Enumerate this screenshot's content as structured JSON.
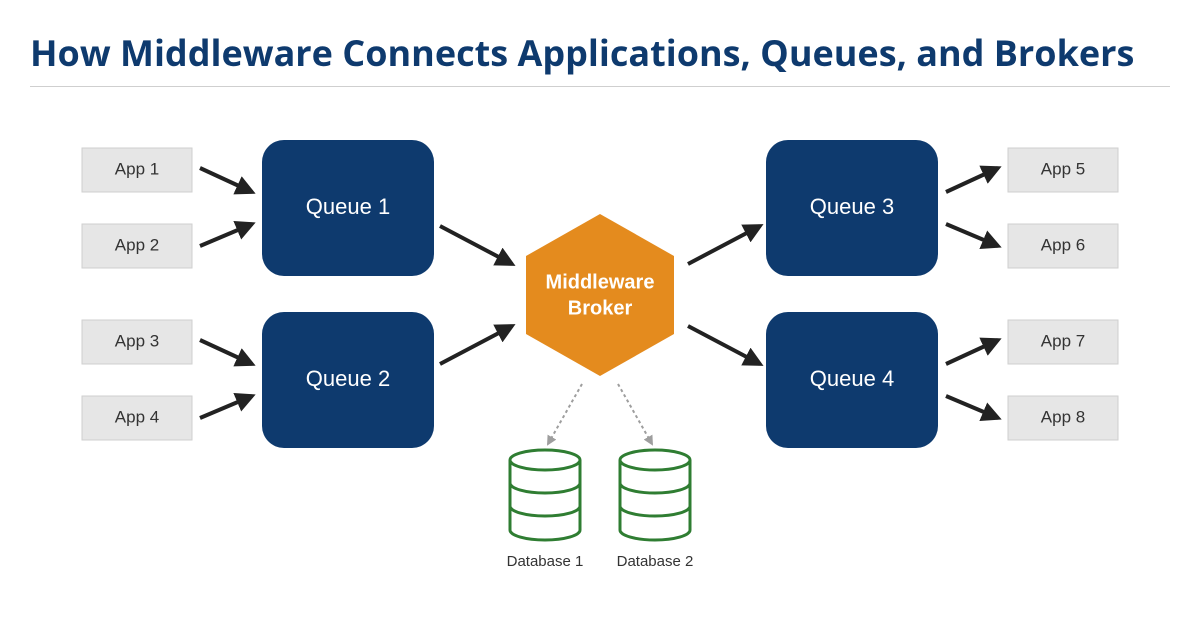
{
  "title": "How Middleware Connects Applications, Queues, and Brokers",
  "apps_left": [
    "App 1",
    "App 2",
    "App 3",
    "App 4"
  ],
  "apps_right": [
    "App 5",
    "App 6",
    "App 7",
    "App 8"
  ],
  "queues_left": [
    "Queue 1",
    "Queue 2"
  ],
  "queues_right": [
    "Queue 3",
    "Queue 4"
  ],
  "broker": {
    "line1": "Middleware",
    "line2": "Broker"
  },
  "databases": [
    "Database 1",
    "Database 2"
  ],
  "colors": {
    "title": "#0e3a6e",
    "queue": "#0e3a6e",
    "broker": "#e48b1e",
    "app_bg": "#e6e6e6",
    "db_stroke": "#2f7d32"
  }
}
